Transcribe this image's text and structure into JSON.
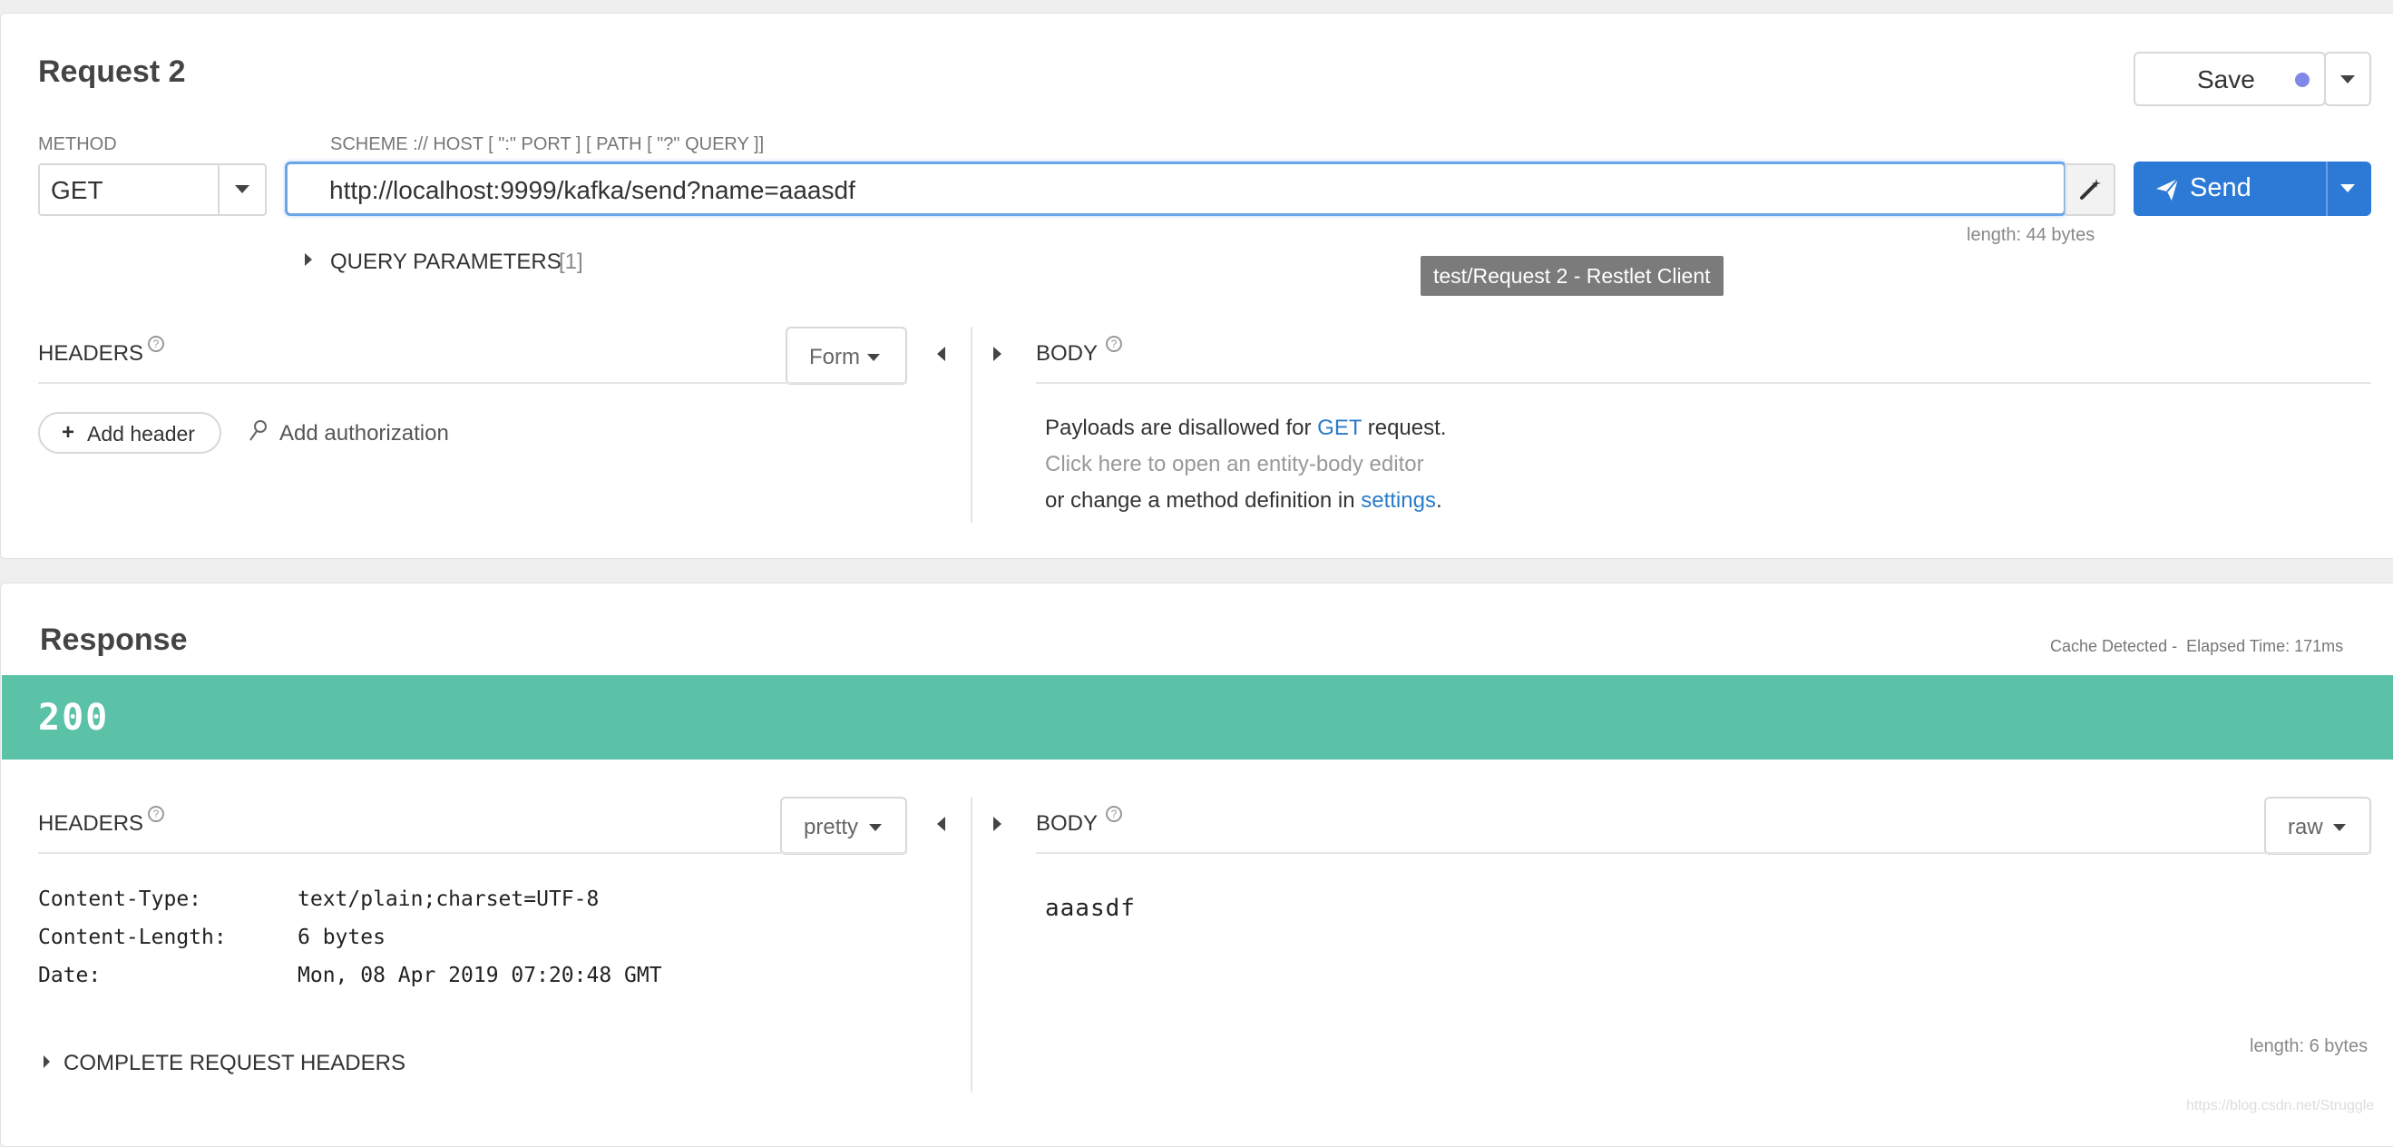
{
  "request": {
    "title": "Request 2",
    "save_label": "Save",
    "method_label": "METHOD",
    "method_value": "GET",
    "url_label": "SCHEME :// HOST [ \":\" PORT ] [ PATH [ \"?\" QUERY ]]",
    "url_value": "http://localhost:9999/kafka/send?name=aaasdf",
    "send_label": "Send",
    "url_length": "length: 44 bytes",
    "query_params_label": "QUERY PARAMETERS",
    "query_params_count": "[1]",
    "tooltip": "test/Request 2 - Restlet Client",
    "headers_label": "HEADERS",
    "headers_mode": "Form",
    "add_header_label": "Add header",
    "add_authorization_label": "Add authorization",
    "body_label": "BODY",
    "body_msg_1_pre": "Payloads are disallowed for ",
    "body_msg_1_method": "GET",
    "body_msg_1_post": " request.",
    "body_msg_2": "Click here to open an entity-body editor",
    "body_msg_3_pre": "or change a method definition in ",
    "body_msg_3_link": "settings",
    "body_msg_3_post": "."
  },
  "response": {
    "title": "Response",
    "cache_info": "Cache Detected -  Elapsed Time: 171ms",
    "status_code": "200",
    "headers_label": "HEADERS",
    "headers_mode": "pretty",
    "body_label": "BODY",
    "body_mode": "raw",
    "headers": [
      {
        "name": "Content-Type:",
        "value": "text/plain;charset=UTF-8"
      },
      {
        "name": "Content-Length:",
        "value": "6 bytes"
      },
      {
        "name": "Date:",
        "value": "Mon, 08 Apr 2019 07:20:48 GMT"
      }
    ],
    "body_text": "aaasdf",
    "complete_headers_label": "COMPLETE REQUEST HEADERS",
    "body_length": "length: 6 bytes"
  },
  "watermark": "https://blog.csdn.net/Struggle",
  "colors": {
    "accent_blue": "#2d7ad6",
    "status_green": "#5bc2a8",
    "link_blue": "#2a7bc8",
    "save_dot": "#7f87e8"
  }
}
